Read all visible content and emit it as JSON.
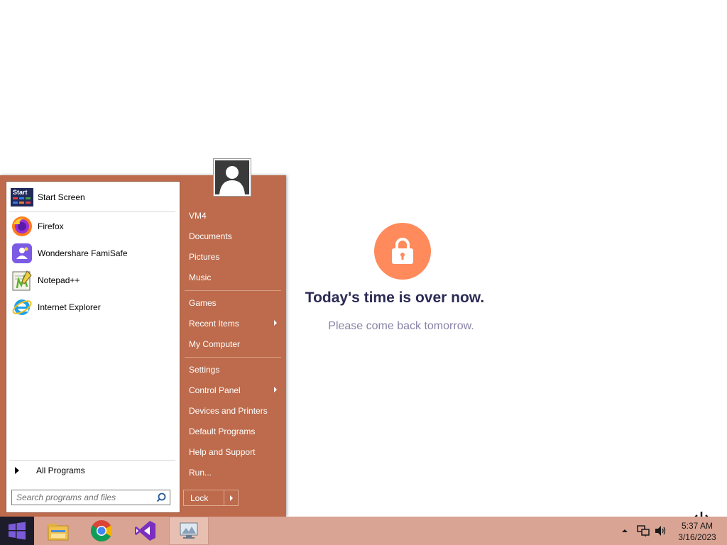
{
  "lock_page": {
    "title": "Today's time is over now.",
    "subtitle": "Please come back tomorrow.",
    "accent_color": "#ff8a5b",
    "icon": "padlock-icon"
  },
  "start_menu": {
    "pinned": [
      {
        "label": "Start Screen",
        "icon": "start-screen-icon"
      },
      {
        "label": "Firefox",
        "icon": "firefox-icon"
      },
      {
        "label": "Wondershare FamiSafe",
        "icon": "famisafe-icon"
      },
      {
        "label": "Notepad++",
        "icon": "notepadpp-icon"
      },
      {
        "label": "Internet Explorer",
        "icon": "internet-explorer-icon"
      }
    ],
    "start_tile_text": "Start",
    "all_programs": "All Programs",
    "search_placeholder": "Search programs and files",
    "right_items": [
      {
        "label": "VM4"
      },
      {
        "label": "Documents"
      },
      {
        "label": "Pictures"
      },
      {
        "label": "Music"
      },
      {
        "label": "Games"
      },
      {
        "label": "Recent Items",
        "submenu": true
      },
      {
        "label": "My Computer"
      },
      {
        "label": "Settings"
      },
      {
        "label": "Control Panel",
        "submenu": true
      },
      {
        "label": "Devices and Printers"
      },
      {
        "label": "Default Programs"
      },
      {
        "label": "Help and Support"
      },
      {
        "label": "Run..."
      }
    ],
    "lock_button": "Lock",
    "menu_color": "#bd6b4c"
  },
  "taskbar": {
    "apps": [
      "file-explorer-icon",
      "chrome-icon",
      "visual-studio-icon",
      "remote-desktop-icon"
    ],
    "clock": {
      "time": "5:37 AM",
      "date": "3/16/2023"
    },
    "color": "#d9a493"
  }
}
